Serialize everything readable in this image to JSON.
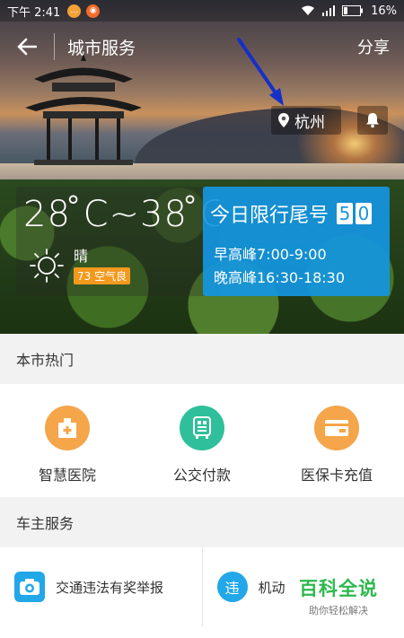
{
  "status_bar": {
    "time": "下午 2:41",
    "battery": "16%"
  },
  "header": {
    "title": "城市服务",
    "share_label": "分享"
  },
  "location": {
    "city": "杭州"
  },
  "weather": {
    "temperature": "28 ̊C~38 ̊C",
    "condition": "晴",
    "aqi": "73 空气良"
  },
  "traffic_limit": {
    "title": "今日限行尾号",
    "digits": [
      "5",
      "0"
    ],
    "morning_peak": "早高峰7:00-9:00",
    "evening_peak": "晚高峰16:30-18:30"
  },
  "hot_section": {
    "title": "本市热门",
    "items": [
      {
        "label": "智慧医院",
        "icon": "hospital-icon",
        "color": "#f5a54a"
      },
      {
        "label": "公交付款",
        "icon": "bus-pay-icon",
        "color": "#2fbf9a"
      },
      {
        "label": "医保卡充值",
        "icon": "card-icon",
        "color": "#f5a54a"
      }
    ]
  },
  "car_section": {
    "title": "车主服务",
    "items": [
      {
        "label": "交通违法有奖举报",
        "icon": "camera-icon"
      },
      {
        "label": "机动",
        "icon": "violation-icon",
        "icon_text": "违"
      }
    ]
  },
  "watermark": {
    "main": "百科全说",
    "sub": "助你轻松解决"
  },
  "colors": {
    "accent_blue": "#1a94e0",
    "aqi_orange": "#f39a1e",
    "watermark_green": "#2db84d"
  }
}
